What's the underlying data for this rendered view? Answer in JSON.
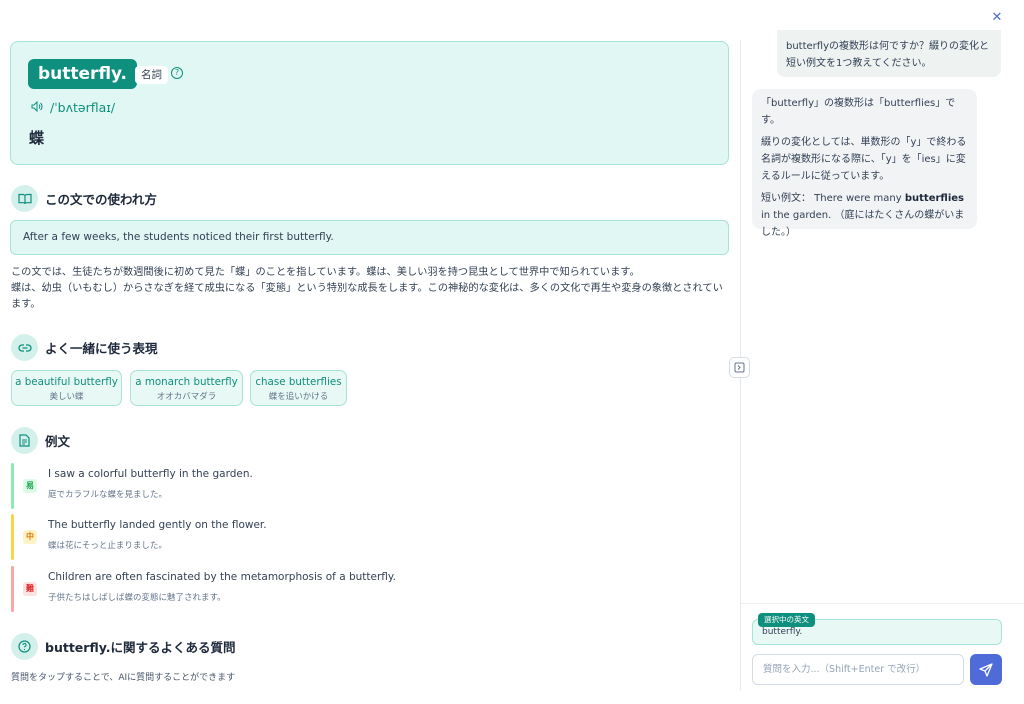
{
  "close_label": "✕",
  "word": {
    "headword": "butterfly.",
    "pos": "名詞",
    "pronunciation": "/ˈbʌtərflaɪ/",
    "meaning": "蝶"
  },
  "usage": {
    "title": "この文での使われ方",
    "sentence": "After a few weeks, the students noticed their first butterfly.",
    "explanation_1": "この文では、生徒たちが数週間後に初めて見た「蝶」のことを指しています。蝶は、美しい羽を持つ昆虫として世界中で知られています。",
    "explanation_2": "蝶は、幼虫（いもむし）からさなぎを経て成虫になる「変態」という特別な成長をします。この神秘的な変化は、多くの文化で再生や変身の象徴とされています。"
  },
  "collocations": {
    "title": "よく一緒に使う表現",
    "items": [
      {
        "en": "a beautiful butterfly",
        "ja": "美しい蝶"
      },
      {
        "en": "a monarch butterfly",
        "ja": "オオカバマダラ"
      },
      {
        "en": "chase butterflies",
        "ja": "蝶を追いかける"
      }
    ]
  },
  "examples": {
    "title": "例文",
    "items": [
      {
        "level": "易",
        "en": "I saw a colorful butterfly in the garden.",
        "ja": "庭でカラフルな蝶を見ました。",
        "color": "#22c55e"
      },
      {
        "level": "中",
        "en": "The butterfly landed gently on the flower.",
        "ja": "蝶は花にそっと止まりました。",
        "color": "#f59e0b"
      },
      {
        "level": "難",
        "en": "Children are often fascinated by the metamorphosis of a butterfly.",
        "ja": "子供たちはしばしば蝶の変態に魅了されます。",
        "color": "#ef4444"
      }
    ]
  },
  "faq": {
    "title": "butterfly.に関するよくある質問",
    "note": "質問をタップすることで、AIに質問することができます"
  },
  "chat": {
    "user_message": "butterflyの複数形は何ですか？綴りの変化と短い例文を1つ教えてください。",
    "ai_p1": "「butterfly」の複数形は「butterflies」です。",
    "ai_p2": "綴りの変化としては、単数形の「y」で終わる名詞が複数形になる際に、「y」を「ies」に変えるルールに従っています。",
    "ai_p3_prefix": "短い例文： There were many ",
    "ai_p3_bold": "butterflies",
    "ai_p3_suffix": " in the garden. （庭にはたくさんの蝶がいました。）"
  },
  "input": {
    "selected_label": "選択中の英文",
    "selected_text": "butterfly.",
    "placeholder": "質問を入力...（Shift+Enter で改行）"
  }
}
